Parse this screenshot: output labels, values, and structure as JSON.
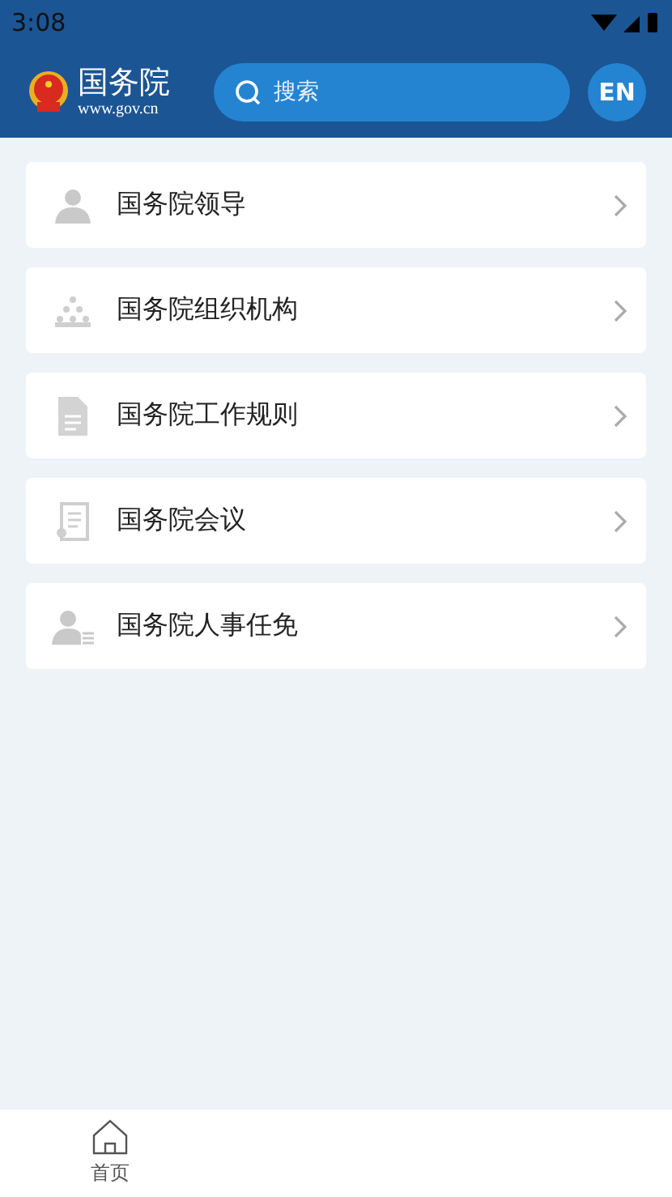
{
  "status_bar": {
    "time": "3:08"
  },
  "header": {
    "title": "国务院",
    "subtitle": "www.gov.cn",
    "search": {
      "placeholder": "搜索"
    },
    "language_button": "EN"
  },
  "menu": [
    {
      "label": "国务院领导",
      "kind": "leader"
    },
    {
      "label": "国务院组织机构",
      "kind": "org"
    },
    {
      "label": "国务院工作规则",
      "kind": "document"
    },
    {
      "label": "国务院会议",
      "kind": "meeting"
    },
    {
      "label": "国务院人事任免",
      "kind": "personnel"
    }
  ],
  "bottom_nav": [
    {
      "label": "首页",
      "selected": false
    }
  ]
}
